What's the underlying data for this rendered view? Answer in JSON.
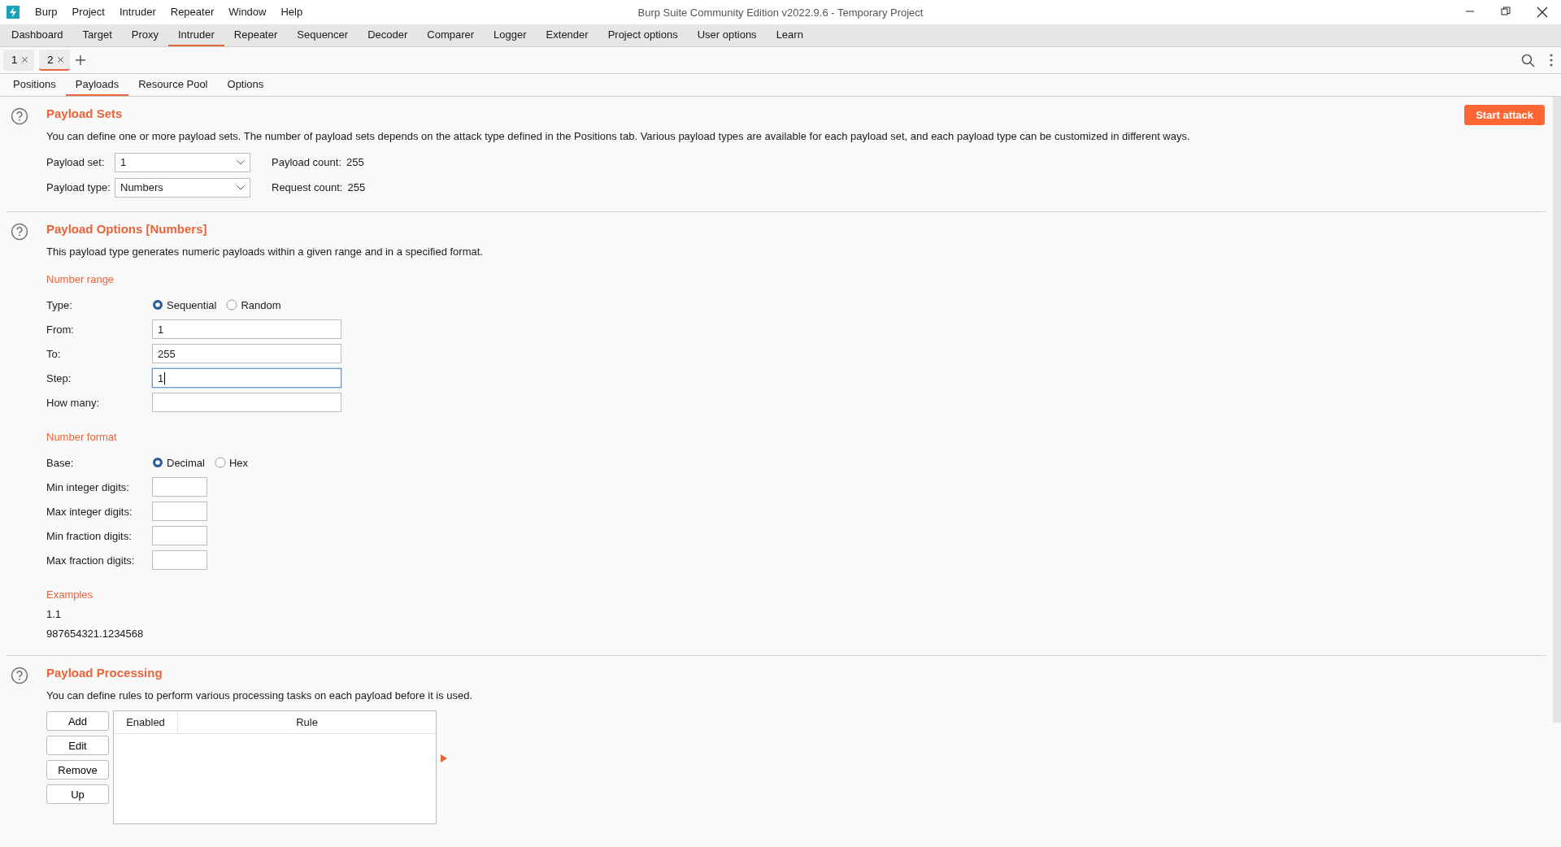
{
  "window": {
    "title": "Burp Suite Community Edition v2022.9.6 - Temporary Project"
  },
  "menu": [
    "Burp",
    "Project",
    "Intruder",
    "Repeater",
    "Window",
    "Help"
  ],
  "main_tabs": [
    {
      "label": "Dashboard",
      "selected": false
    },
    {
      "label": "Target",
      "selected": false
    },
    {
      "label": "Proxy",
      "selected": false
    },
    {
      "label": "Intruder",
      "selected": true
    },
    {
      "label": "Repeater",
      "selected": false
    },
    {
      "label": "Sequencer",
      "selected": false
    },
    {
      "label": "Decoder",
      "selected": false
    },
    {
      "label": "Comparer",
      "selected": false
    },
    {
      "label": "Logger",
      "selected": false
    },
    {
      "label": "Extender",
      "selected": false
    },
    {
      "label": "Project options",
      "selected": false
    },
    {
      "label": "User options",
      "selected": false
    },
    {
      "label": "Learn",
      "selected": false
    }
  ],
  "session_tabs": [
    {
      "label": "1",
      "selected": false
    },
    {
      "label": "2",
      "selected": true
    }
  ],
  "sub_tabs": [
    {
      "label": "Positions",
      "selected": false
    },
    {
      "label": "Payloads",
      "selected": true
    },
    {
      "label": "Resource Pool",
      "selected": false
    },
    {
      "label": "Options",
      "selected": false
    }
  ],
  "payload_sets": {
    "title": "Payload Sets",
    "description": "You can define one or more payload sets. The number of payload sets depends on the attack type defined in the Positions tab. Various payload types are available for each payload set, and each payload type can be customized in different ways.",
    "start_button": "Start attack",
    "rows": [
      {
        "label": "Payload set:",
        "value": "1",
        "count_label": "Payload count:",
        "count": "255"
      },
      {
        "label": "Payload type:",
        "value": "Numbers",
        "count_label": "Request count:",
        "count": "255"
      }
    ]
  },
  "payload_options": {
    "title": "Payload Options [Numbers]",
    "description": "This payload type generates numeric payloads within a given range and in a specified format.",
    "number_range": {
      "heading": "Number range",
      "type_label": "Type:",
      "type_options": [
        {
          "label": "Sequential",
          "selected": true
        },
        {
          "label": "Random",
          "selected": false
        }
      ],
      "fields": [
        {
          "label": "From:",
          "value": "1",
          "focused": false
        },
        {
          "label": "To:",
          "value": "255",
          "focused": false
        },
        {
          "label": "Step:",
          "value": "1",
          "focused": true
        },
        {
          "label": "How many:",
          "focused": false
        }
      ]
    },
    "number_format": {
      "heading": "Number format",
      "base_label": "Base:",
      "base_options": [
        {
          "label": "Decimal",
          "selected": true
        },
        {
          "label": "Hex",
          "selected": false
        }
      ],
      "fields": [
        {
          "label": "Min integer digits:"
        },
        {
          "label": "Max integer digits:"
        },
        {
          "label": "Min fraction digits:"
        },
        {
          "label": "Max fraction digits:"
        }
      ]
    },
    "examples": {
      "heading": "Examples",
      "items": [
        "1.1",
        "987654321.1234568"
      ]
    }
  },
  "payload_processing": {
    "title": "Payload Processing",
    "description": "You can define rules to perform various processing tasks on each payload before it is used.",
    "buttons": [
      "Add",
      "Edit",
      "Remove",
      "Up"
    ],
    "columns": [
      "Enabled",
      "Rule"
    ]
  }
}
